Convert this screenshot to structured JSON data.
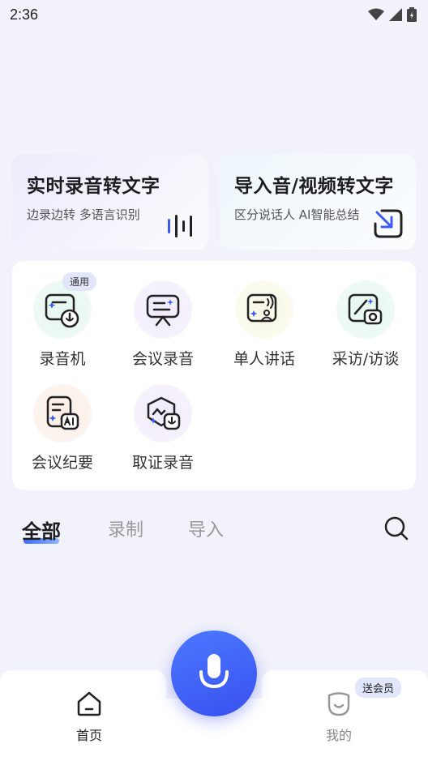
{
  "status_bar": {
    "time": "2:36"
  },
  "cards": {
    "realtime": {
      "title": "实时录音转文字",
      "subtitle": "边录边转 多语言识别"
    },
    "import": {
      "title": "导入音/视频转文字",
      "subtitle": "区分说话人 AI智能总结"
    }
  },
  "tools": [
    {
      "label": "录音机",
      "badge": "通用"
    },
    {
      "label": "会议录音"
    },
    {
      "label": "单人讲话"
    },
    {
      "label": "采访/访谈"
    },
    {
      "label": "会议纪要"
    },
    {
      "label": "取证录音"
    }
  ],
  "tabs": [
    {
      "label": "全部",
      "active": true
    },
    {
      "label": "录制",
      "active": false
    },
    {
      "label": "导入",
      "active": false
    }
  ],
  "bottom_nav": {
    "home": "首页",
    "mine": "我的",
    "vip_badge": "送会员"
  },
  "colors": {
    "accent": "#3d5af1",
    "background": "#f2f2fb"
  }
}
